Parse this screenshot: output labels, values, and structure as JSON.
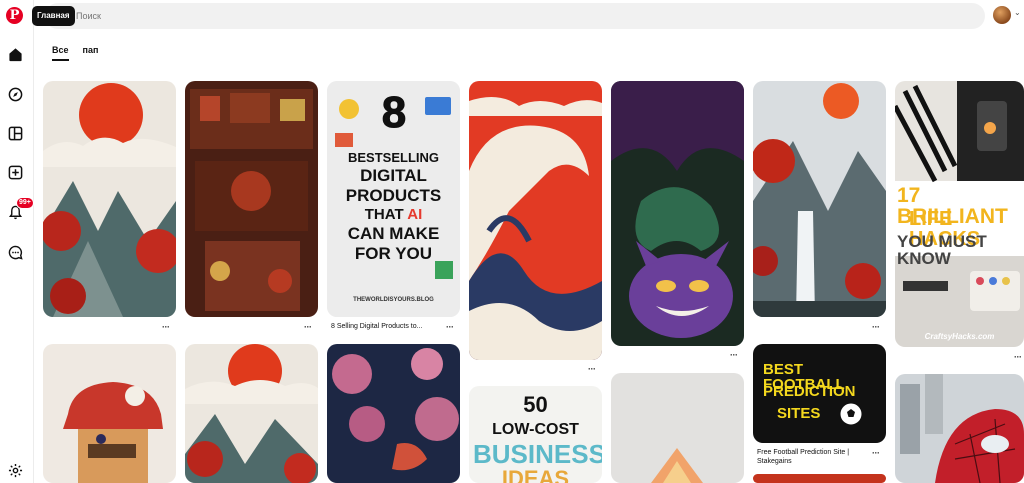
{
  "header": {
    "tooltip": "Главная",
    "search_placeholder": "Поиск",
    "notifications_badge": "99+"
  },
  "tabs": [
    {
      "label": "Все"
    },
    {
      "label": "пап"
    }
  ],
  "pins": {
    "digital_products": {
      "number": "8",
      "line1": "BESTSELLING",
      "line2": "DIGITAL",
      "line3": "PRODUCTS",
      "line4a": "THAT ",
      "line4b": "AI",
      "line5": "CAN MAKE",
      "line6": "FOR YOU",
      "footer": "THEWORLDISYOURS.BLOG",
      "title": "8 Selling Digital Products to..."
    },
    "life_hacks": {
      "line1": "17 BRILLIANT",
      "line2": "LIFE HACKS",
      "line3": "YOU MUST KNOW",
      "watermark": "CraftsyHacks.com"
    },
    "football": {
      "line1": "BEST FOOTBALL",
      "line2": "PREDICTION",
      "line3": "SITES",
      "title": "Free Football Prediction Site | Stakegains"
    },
    "business": {
      "line1": "50",
      "line2": "LOW-COST",
      "line3": "BUSINESS",
      "line4": "IDEAS"
    },
    "dots": "···"
  }
}
